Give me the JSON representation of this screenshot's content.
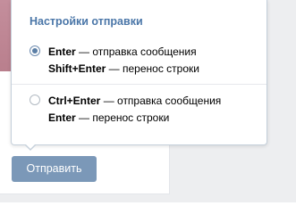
{
  "popup": {
    "title": "Настройки отправки",
    "options": [
      {
        "selected": true,
        "lines": [
          {
            "key": "Enter",
            "desc": " — отправка сообщения"
          },
          {
            "key": "Shift+Enter",
            "desc": " — перенос строки"
          }
        ]
      },
      {
        "selected": false,
        "lines": [
          {
            "key": "Ctrl+Enter",
            "desc": " — отправка сообщения"
          },
          {
            "key": "Enter",
            "desc": " — перенос строки"
          }
        ]
      }
    ]
  },
  "composer": {
    "send_label": "Отправить"
  },
  "colors": {
    "accent": "#4a76a8",
    "button": "#7b98b8",
    "background": "#edeef0"
  }
}
